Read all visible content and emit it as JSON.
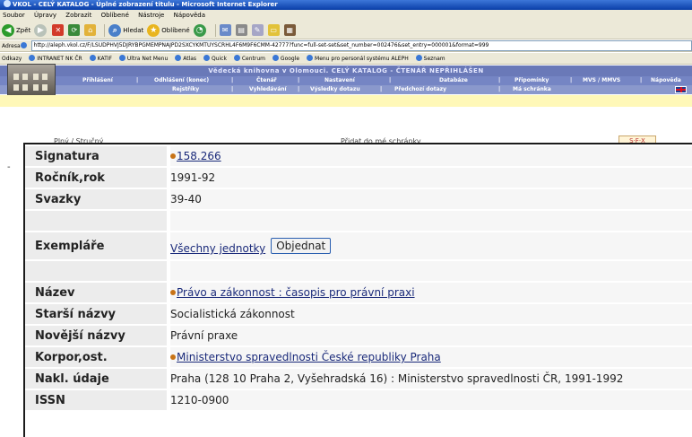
{
  "window": {
    "title": "VKOL - CELÝ KATALOG - Úplné zobrazení titulu - Microsoft Internet Explorer"
  },
  "menu": [
    "Soubor",
    "Úpravy",
    "Zobrazit",
    "Oblíbené",
    "Nástroje",
    "Nápověda"
  ],
  "toolbar": {
    "back": "Zpět",
    "search": "Hledat",
    "favorites": "Oblíbené"
  },
  "address": {
    "label": "Adresa",
    "url": "http://aleph.vkol.cz/F/LSUDPHVJ5DJRYBPGMEMPNAJPD2SXCYKMTUYSCRHL4F6M9F6CMM-42777?func=full-set-set&set_number=002476&set_entry=000001&format=999"
  },
  "links": {
    "label": "Odkazy",
    "items": [
      "INTRANET NK ČR",
      "KATIF",
      "Ultra Net Menu",
      "Atlas",
      "Quick",
      "Centrum",
      "Google",
      "Menu pro personál systému ALEPH",
      "Seznam"
    ]
  },
  "library": {
    "banner": "Vědecká knihovna v Olomouci. CELÝ KATALOG - ČTENÁŘ NEPŘIHLÁŠEN",
    "nav1": [
      "Přihlášení",
      "Odhlášení (konec)",
      "Čtenář",
      "Nastavení",
      "Databáze",
      "Připomínky",
      "MVS / MMVS",
      "Nápověda"
    ],
    "nav2": [
      "Rejstříky",
      "Vyhledávání",
      "Výsledky dotazu",
      "Předchozí dotazy",
      "Má schránka"
    ]
  },
  "hidden_row": {
    "left": "Plný / Stručný",
    "middle": "Přidat do mé schránky",
    "sfx": "S·F·X"
  },
  "record": {
    "rows": [
      {
        "label": "Signatura",
        "value": "158.266",
        "link": true
      },
      {
        "label": "Ročník,rok",
        "value": "1991-92",
        "link": false
      },
      {
        "label": "Svazky",
        "value": "39-40",
        "link": false
      },
      {
        "label": "",
        "value": "",
        "link": false
      },
      {
        "label": "Exempláře",
        "value": "Všechny jednotky",
        "button": "Objednat",
        "link": true
      },
      {
        "label": "",
        "value": "",
        "link": false
      },
      {
        "label": "Název",
        "value": "Právo a zákonnost : časopis pro právní praxi",
        "link": true
      },
      {
        "label": "Starší názvy",
        "value": "Socialistická zákonnost",
        "link": false
      },
      {
        "label": "Novější názvy",
        "value": "Právní praxe",
        "link": false
      },
      {
        "label": "Korpor,ost.",
        "value": "Ministerstvo spravedlnosti České republiky Praha",
        "link": true
      },
      {
        "label": "Nakl. údaje",
        "value": "Praha (128 10 Praha 2, Vyšehradská 16) : Ministerstvo spravedlnosti ČR, 1991-1992",
        "link": false
      },
      {
        "label": "ISSN",
        "value": "1210-0900",
        "link": false
      }
    ]
  }
}
